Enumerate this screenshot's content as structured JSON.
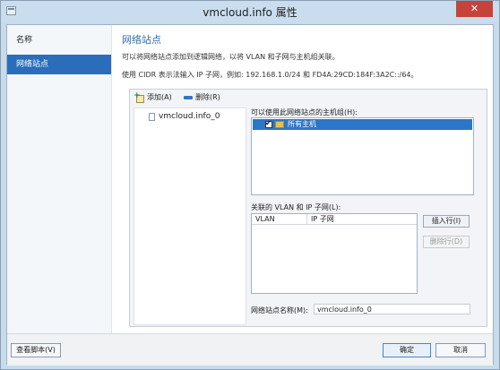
{
  "window": {
    "title": "vmcloud.info 属性",
    "close_glyph": "✕"
  },
  "nav": {
    "items": [
      {
        "label": "名称",
        "selected": false
      },
      {
        "label": "网络站点",
        "selected": true
      }
    ]
  },
  "main": {
    "title": "网络站点",
    "desc1": "可以将网络站点添加到逻辑网络，以将 VLAN 和子网与主机组关联。",
    "desc2": "使用 CIDR 表示法输入 IP 子网，例如: 192.168.1.0/24 和 FD4A:29CD:184F:3A2C::/64。"
  },
  "toolbar": {
    "add_label": "添加(A)",
    "remove_label": "删除(R)"
  },
  "sites": {
    "items": [
      "vmcloud.info_0"
    ]
  },
  "host_groups": {
    "label": "可以使用此网络站点的主机组(H):",
    "items": [
      {
        "label": "所有主机",
        "checked": true
      }
    ]
  },
  "subnets": {
    "label": "关联的 VLAN 和 IP 子网(L):",
    "columns": [
      "VLAN",
      "IP 子网"
    ],
    "insert_row": "插入行(I)",
    "delete_row": "删除行(D)"
  },
  "site_name": {
    "label": "网络站点名称(M):",
    "value": "vmcloud.info_0"
  },
  "footer": {
    "view_script": "查看脚本(V)",
    "ok": "确定",
    "cancel": "取消"
  },
  "colors": {
    "accent": "#2a6ebb",
    "title_text": "#2f6faa",
    "close": "#c7433a"
  }
}
